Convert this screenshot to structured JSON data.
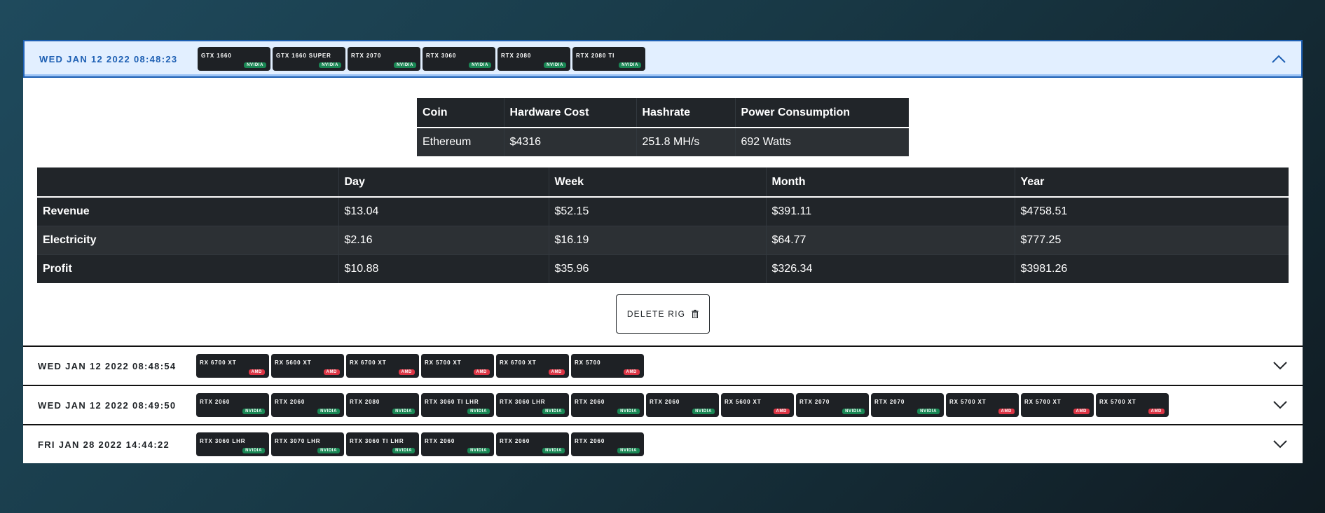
{
  "rigs": [
    {
      "date": "WED JAN 12 2022 08:48:23",
      "expanded": true,
      "gpus": [
        {
          "name": "GTX 1660",
          "brand": "NVIDIA"
        },
        {
          "name": "GTX 1660 SUPER",
          "brand": "NVIDIA"
        },
        {
          "name": "RTX 2070",
          "brand": "NVIDIA"
        },
        {
          "name": "RTX 3060",
          "brand": "NVIDIA"
        },
        {
          "name": "RTX 2080",
          "brand": "NVIDIA"
        },
        {
          "name": "RTX 2080 TI",
          "brand": "NVIDIA"
        }
      ],
      "summary": {
        "headers": [
          "Coin",
          "Hardware Cost",
          "Hashrate",
          "Power Consumption"
        ],
        "values": [
          "Ethereum",
          "$4316",
          "251.8 MH/s",
          "692 Watts"
        ]
      },
      "profit": {
        "headers": [
          "",
          "Day",
          "Week",
          "Month",
          "Year"
        ],
        "rows": [
          {
            "label": "Revenue",
            "values": [
              "$13.04",
              "$52.15",
              "$391.11",
              "$4758.51"
            ]
          },
          {
            "label": "Electricity",
            "values": [
              "$2.16",
              "$16.19",
              "$64.77",
              "$777.25"
            ]
          },
          {
            "label": "Profit",
            "values": [
              "$10.88",
              "$35.96",
              "$326.34",
              "$3981.26"
            ]
          }
        ]
      },
      "delete_label": "DELETE RIG"
    },
    {
      "date": "WED JAN 12 2022 08:48:54",
      "expanded": false,
      "gpus": [
        {
          "name": "RX 6700 XT",
          "brand": "AMD"
        },
        {
          "name": "RX 5600 XT",
          "brand": "AMD"
        },
        {
          "name": "RX 6700 XT",
          "brand": "AMD"
        },
        {
          "name": "RX 5700 XT",
          "brand": "AMD"
        },
        {
          "name": "RX 6700 XT",
          "brand": "AMD"
        },
        {
          "name": "RX 5700",
          "brand": "AMD"
        }
      ]
    },
    {
      "date": "WED JAN 12 2022 08:49:50",
      "expanded": false,
      "gpus": [
        {
          "name": "RTX 2060",
          "brand": "NVIDIA"
        },
        {
          "name": "RTX 2060",
          "brand": "NVIDIA"
        },
        {
          "name": "RTX 2080",
          "brand": "NVIDIA"
        },
        {
          "name": "RTX 3060 TI LHR",
          "brand": "NVIDIA"
        },
        {
          "name": "RTX 3060 LHR",
          "brand": "NVIDIA"
        },
        {
          "name": "RTX 2060",
          "brand": "NVIDIA"
        },
        {
          "name": "RTX 2060",
          "brand": "NVIDIA"
        },
        {
          "name": "RX 5600 XT",
          "brand": "AMD"
        },
        {
          "name": "RTX 2070",
          "brand": "NVIDIA"
        },
        {
          "name": "RTX 2070",
          "brand": "NVIDIA"
        },
        {
          "name": "RX 5700 XT",
          "brand": "AMD"
        },
        {
          "name": "RX 5700 XT",
          "brand": "AMD"
        },
        {
          "name": "RX 5700 XT",
          "brand": "AMD"
        }
      ]
    },
    {
      "date": "FRI JAN 28 2022 14:44:22",
      "expanded": false,
      "gpus": [
        {
          "name": "RTX 3060 LHR",
          "brand": "NVIDIA"
        },
        {
          "name": "RTX 3070 LHR",
          "brand": "NVIDIA"
        },
        {
          "name": "RTX 3060 TI LHR",
          "brand": "NVIDIA"
        },
        {
          "name": "RTX 2060",
          "brand": "NVIDIA"
        },
        {
          "name": "RTX 2060",
          "brand": "NVIDIA"
        },
        {
          "name": "RTX 2060",
          "brand": "NVIDIA"
        }
      ]
    }
  ],
  "colors": {
    "nvidia_badge": "#198754",
    "amd_badge": "#dc3545",
    "open_header_bg": "#e2efff",
    "open_header_text": "#1d5fb3",
    "chip_bg": "#1e2125",
    "table_bg": "#212529"
  },
  "icons": {
    "expanded_chevron": "chevron-up-icon",
    "collapsed_chevron": "chevron-down-icon",
    "delete": "trash-icon"
  }
}
